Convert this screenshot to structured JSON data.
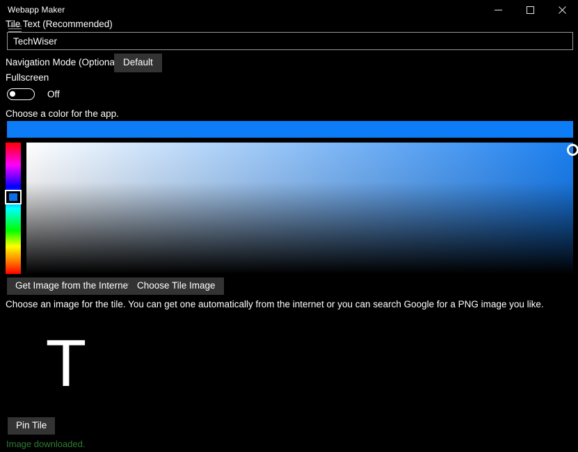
{
  "window": {
    "title": "Webapp Maker",
    "controls": {
      "minimize": "minimize-icon",
      "maximize": "maximize-icon",
      "close": "close-icon"
    }
  },
  "form": {
    "tile_text_label": "Tile Text (Recommended)",
    "tile_text_value": "TechWiser",
    "tile_text_placeholder": "",
    "nav_mode_label": "Navigation Mode (Optional)",
    "nav_mode_value": "Default",
    "fullscreen_label": "Fullscreen",
    "fullscreen_state": "Off"
  },
  "color": {
    "choose_color_label": "Choose a color for the app.",
    "selected_color": "#0d7df7",
    "hue_cursor_color": "#0b6fe8",
    "sv_gradient_hue": "#1a7ff0"
  },
  "image": {
    "get_image_button": "Get Image from the Internet",
    "choose_tile_button": "Choose Tile Image",
    "help_text": "Choose an image for the tile. You can get one automatically from the internet or you can search Google for a PNG image you like.",
    "tile_glyph": "T"
  },
  "footer": {
    "pin_tile_button": "Pin Tile",
    "status_text": "Image downloaded.",
    "status_color": "#2f7d32"
  }
}
